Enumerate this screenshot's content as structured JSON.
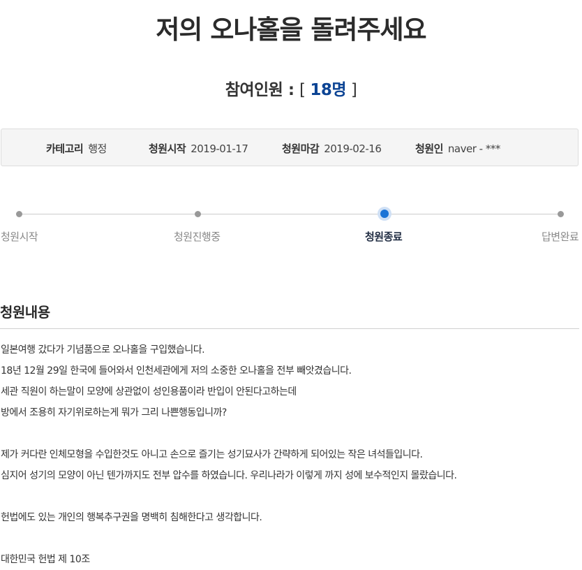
{
  "petition": {
    "title": "저의 오나홀을 돌려주세요",
    "participants_label": "참여인원 : ",
    "bracket_open": "[ ",
    "participants_count": "18명",
    "bracket_close": " ]"
  },
  "info": {
    "category_label": "카테고리",
    "category_value": "행정",
    "start_label": "청원시작",
    "start_value": "2019-01-17",
    "end_label": "청원마감",
    "end_value": "2019-02-16",
    "author_label": "청원인",
    "author_value": "naver - ***"
  },
  "progress": {
    "steps": [
      "청원시작",
      "청원진행중",
      "청원종료",
      "답변완료"
    ],
    "active_index": 2
  },
  "content": {
    "section_title": "청원내용",
    "lines": [
      "일본여행 갔다가 기념품으로 오나홀을 구입했습니다.",
      "18년 12월 29일 한국에 들어와서 인천세관에게 저의 소중한 오나홀을 전부 빼앗겼습니다.",
      "세관 직원이 하는말이 모양에 상관없이 성인용품이라 반입이 안된다고하는데",
      "방에서 조용히 자기위로하는게 뭐가 그리 나쁜행동입니까?",
      "",
      "제가 커다란 인체모형을 수입한것도 아니고 손으로 즐기는 성기묘사가 간략하게 되어있는 작은 녀석들입니다.",
      "심지어 성기의 모양이 아닌 텐가까지도 전부 압수를 하였습니다. 우리나라가 이렇게 까지 성에 보수적인지 몰랐습니다.",
      "",
      "헌법에도 있는 개인의 행복추구권을 명백히 침해한다고 생각합니다.",
      "",
      "대한민국 헌법 제 10조"
    ]
  }
}
